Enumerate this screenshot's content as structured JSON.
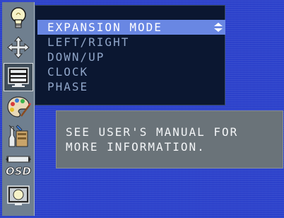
{
  "osd": {
    "icons": [
      {
        "name": "brightness-bulb-icon",
        "selected": false
      },
      {
        "name": "position-arrows-icon",
        "selected": false
      },
      {
        "name": "expansion-monitor-icon",
        "selected": true
      },
      {
        "name": "color-palette-icon",
        "selected": false
      },
      {
        "name": "tools-icon",
        "selected": false
      },
      {
        "name": "osd-settings-icon",
        "label": "OSD",
        "selected": false
      },
      {
        "name": "display-info-icon",
        "selected": false
      }
    ],
    "menu": {
      "items": [
        {
          "label": "EXPANSION MODE",
          "highlighted": true
        },
        {
          "label": "LEFT/RIGHT",
          "highlighted": false
        },
        {
          "label": "DOWN/UP",
          "highlighted": false
        },
        {
          "label": "CLOCK",
          "highlighted": false
        },
        {
          "label": "PHASE",
          "highlighted": false
        }
      ]
    },
    "info": {
      "line1": "SEE USER'S MANUAL FOR",
      "line2": "MORE INFORMATION."
    },
    "colors": {
      "background": "#2d43d0",
      "menu_panel": "#0b1731",
      "highlight": "#6987e3",
      "info_box": "#6a7379",
      "icon_column": "#6f7f8f"
    }
  }
}
